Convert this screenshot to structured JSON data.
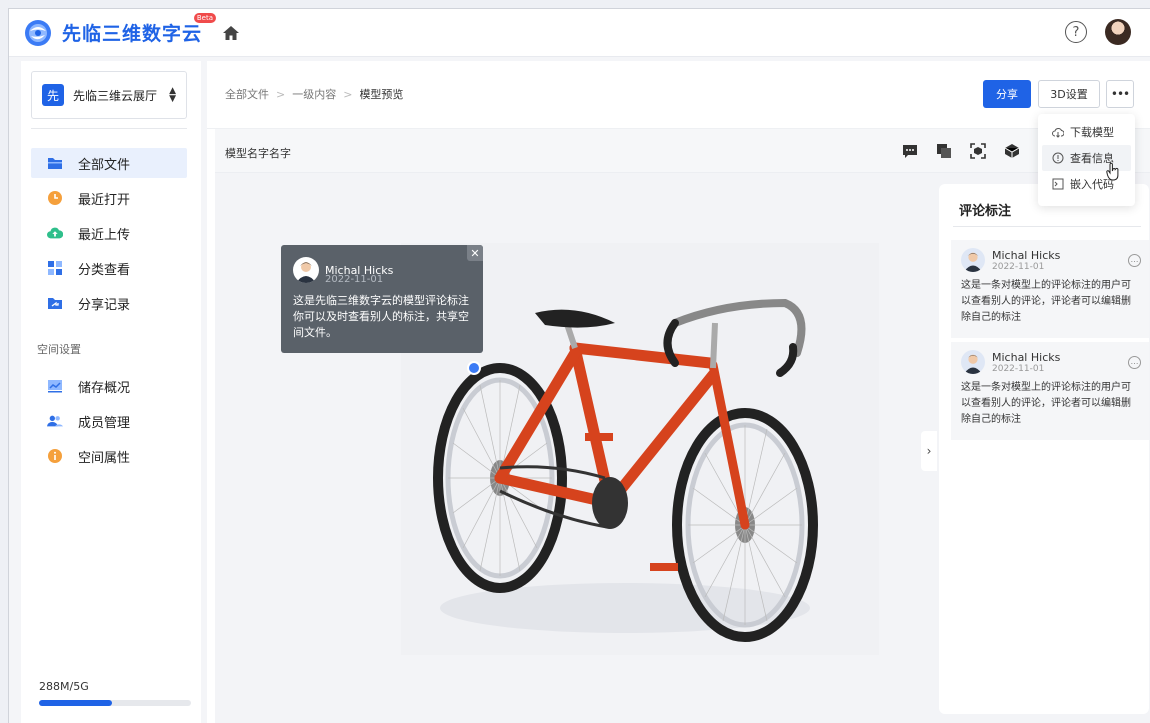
{
  "app": {
    "brand": "先临三维数字云",
    "beta": "Beta"
  },
  "sidebar": {
    "space": {
      "badge": "先",
      "name": "先临三维云展厅"
    },
    "items": [
      {
        "label": "全部文件",
        "icon": "folder-icon",
        "color": "#2f6fe6"
      },
      {
        "label": "最近打开",
        "icon": "clock-icon",
        "color": "#f5a03c"
      },
      {
        "label": "最近上传",
        "icon": "cloud-upload-icon",
        "color": "#2fbf8b"
      },
      {
        "label": "分类查看",
        "icon": "grid-icon",
        "color": "#2f6fe6"
      },
      {
        "label": "分享记录",
        "icon": "share-folder-icon",
        "color": "#2f6fe6"
      }
    ],
    "section_label": "空间设置",
    "settings": [
      {
        "label": "储存概况",
        "icon": "chart-icon",
        "color": "#2f6fe6"
      },
      {
        "label": "成员管理",
        "icon": "users-icon",
        "color": "#2f6fe6"
      },
      {
        "label": "空间属性",
        "icon": "info-icon",
        "color": "#f5a03c"
      }
    ],
    "storage": {
      "label": "288M/5G",
      "used_fraction": 0.48
    }
  },
  "main": {
    "breadcrumb": [
      "全部文件",
      "一级内容",
      "模型预览"
    ],
    "share_label": "分享",
    "settings3d_label": "3D设置",
    "more_label": "•••",
    "model_name": "模型名字名字"
  },
  "dropdown": {
    "items": [
      {
        "label": "下载模型",
        "icon": "cloud-download-icon"
      },
      {
        "label": "查看信息",
        "icon": "info-circle-icon"
      },
      {
        "label": "嵌入代码",
        "icon": "code-icon"
      }
    ]
  },
  "bubble": {
    "name": "Michal Hicks",
    "date": "2022-11-01",
    "text": "这是先临三维数字云的模型评论标注你可以及时查看别人的标注，共享空间文件。",
    "close": "✕"
  },
  "panel": {
    "title": "评论标注",
    "comments": [
      {
        "name": "Michal Hicks",
        "date": "2022-11-01",
        "text": "这是一条对模型上的评论标注的用户可以查看别人的评论，评论者可以编辑删除自己的标注"
      },
      {
        "name": "Michal Hicks",
        "date": "2022-11-01",
        "text": "这是一条对模型上的评论标注的用户可以查看别人的评论，评论者可以编辑删除自己的标注"
      }
    ]
  },
  "colors": {
    "primary": "#1f63e6",
    "marker": "#3b7bf5"
  }
}
